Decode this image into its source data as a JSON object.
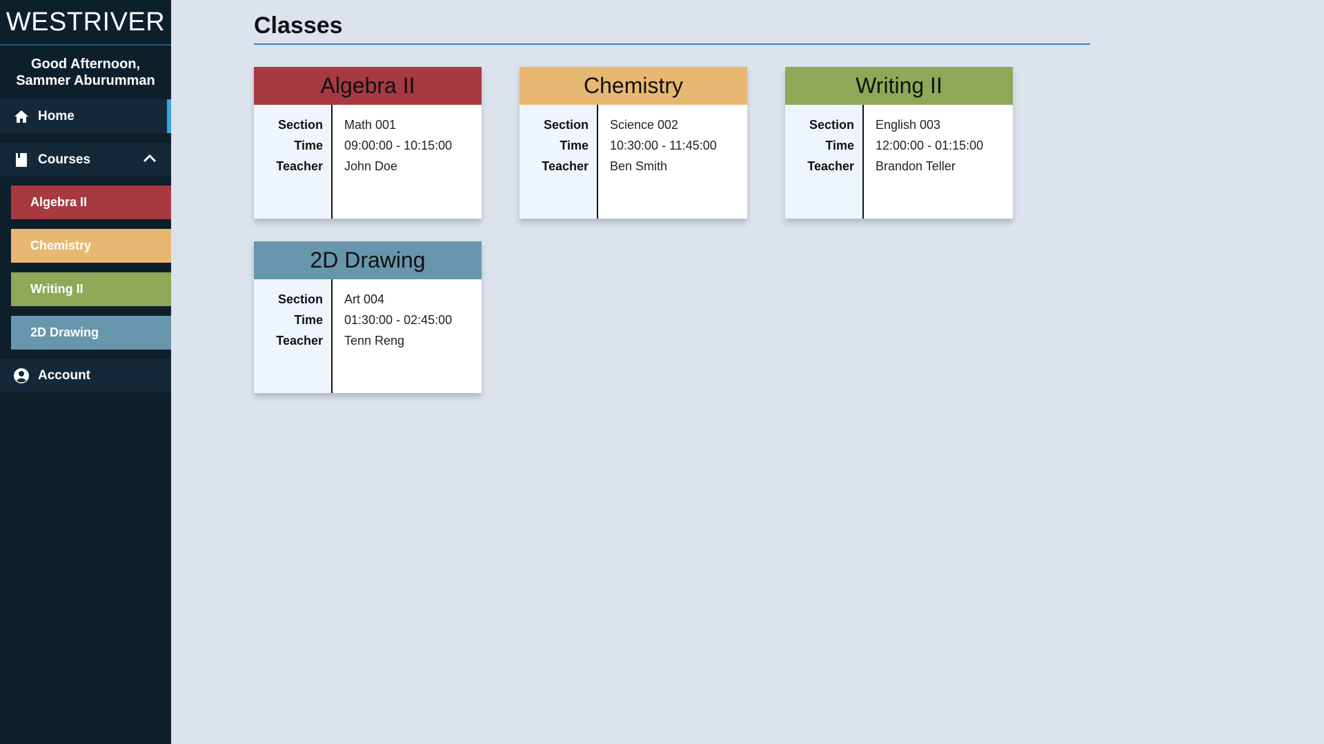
{
  "brand": "WESTRIVER",
  "greeting": {
    "line1": "Good Afternoon,",
    "line2": "Sammer Aburumman"
  },
  "nav": {
    "home": "Home",
    "courses": "Courses",
    "account": "Account",
    "course_items": [
      {
        "label": "Algebra II",
        "color": "#a63a40"
      },
      {
        "label": "Chemistry",
        "color": "#e8b873"
      },
      {
        "label": "Writing II",
        "color": "#8fa858"
      },
      {
        "label": "2D Drawing",
        "color": "#6796ad"
      }
    ]
  },
  "page": {
    "title": "Classes"
  },
  "labels": {
    "section": "Section",
    "time": "Time",
    "teacher": "Teacher"
  },
  "classes": [
    {
      "name": "Algebra II",
      "color": "#a63a40",
      "section": "Math 001",
      "time": "09:00:00 - 10:15:00",
      "teacher": "John Doe"
    },
    {
      "name": "Chemistry",
      "color": "#e8b873",
      "section": "Science 002",
      "time": "10:30:00 - 11:45:00",
      "teacher": "Ben Smith"
    },
    {
      "name": "Writing II",
      "color": "#8fa858",
      "section": "English 003",
      "time": "12:00:00 - 01:15:00",
      "teacher": "Brandon Teller"
    },
    {
      "name": "2D Drawing",
      "color": "#6796ad",
      "section": "Art 004",
      "time": "01:30:00 - 02:45:00",
      "teacher": "Tenn Reng"
    }
  ]
}
